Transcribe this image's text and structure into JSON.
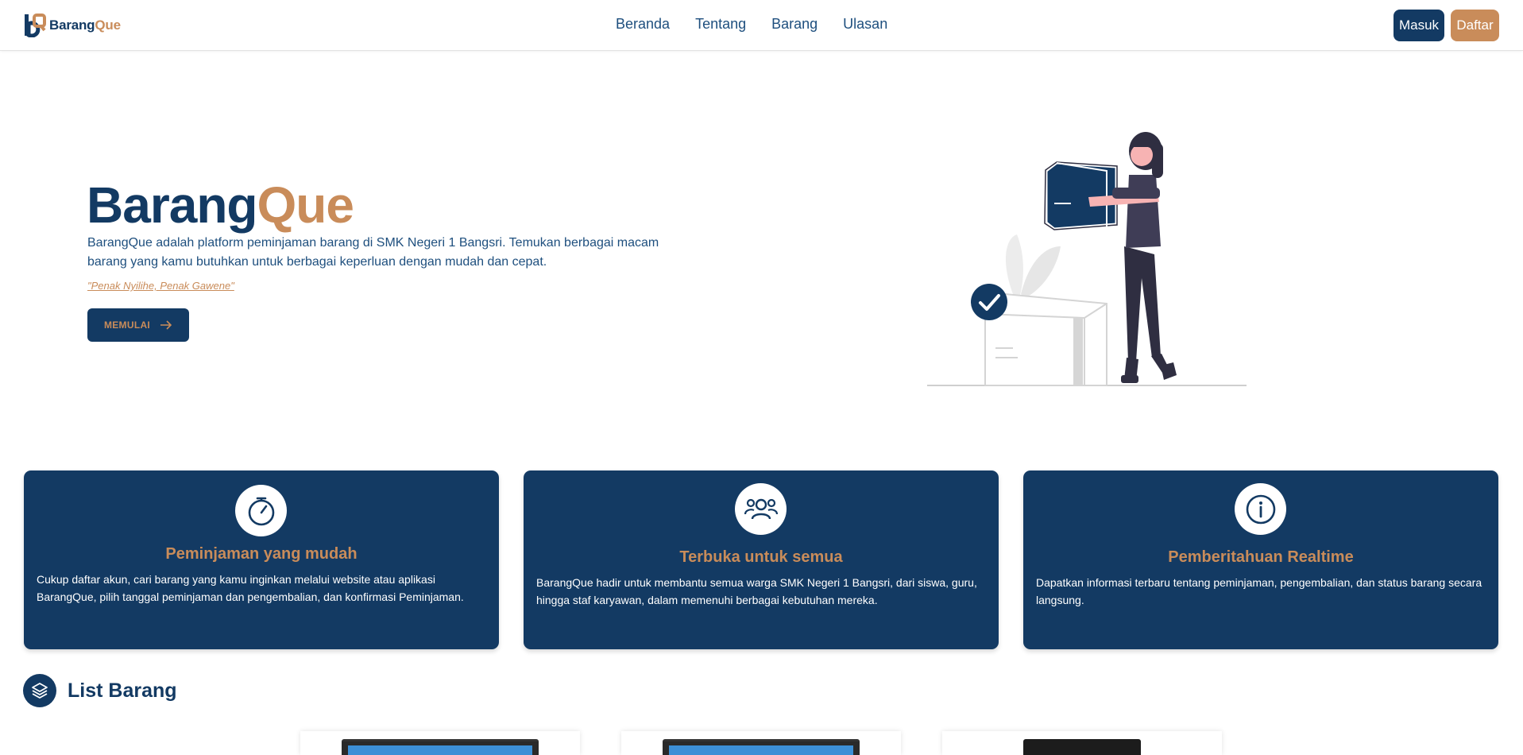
{
  "brand": {
    "name_main": "Barang",
    "name_accent": "Que"
  },
  "nav": {
    "links": [
      {
        "label": "Beranda"
      },
      {
        "label": "Tentang"
      },
      {
        "label": "Barang"
      },
      {
        "label": "Ulasan"
      }
    ],
    "login_label": "Masuk",
    "register_label": "Daftar"
  },
  "hero": {
    "title_main": "Barang",
    "title_accent": "Que",
    "description": "BarangQue adalah platform peminjaman barang di SMK Negeri 1 Bangsri. Temukan berbagai macam barang yang kamu butuhkan untuk berbagai keperluan dengan mudah dan cepat.",
    "quote": "\"Penak Nyilihe, Penak Gawene\"",
    "cta_label": "MEMULAI"
  },
  "features": [
    {
      "icon": "stopwatch-icon",
      "title": "Peminjaman yang mudah",
      "text": "Cukup daftar akun, cari barang yang kamu inginkan melalui website atau aplikasi BarangQue, pilih tanggal peminjaman dan pengembalian, dan konfirmasi Peminjaman."
    },
    {
      "icon": "users-icon",
      "title": "Terbuka untuk semua",
      "text": "BarangQue hadir untuk membantu semua warga SMK Negeri 1 Bangsri, dari siswa, guru, hingga staf karyawan, dalam memenuhi berbagai kebutuhan mereka."
    },
    {
      "icon": "info-icon",
      "title": "Pemberitahuan Realtime",
      "text": "Dapatkan informasi terbaru tentang peminjaman, pengembalian, dan status barang secara langsung."
    }
  ],
  "list_section": {
    "title": "List Barang",
    "icon": "layers-icon"
  },
  "colors": {
    "primary": "#133a63",
    "accent": "#c98c5a",
    "text": "#1e4f7e"
  }
}
